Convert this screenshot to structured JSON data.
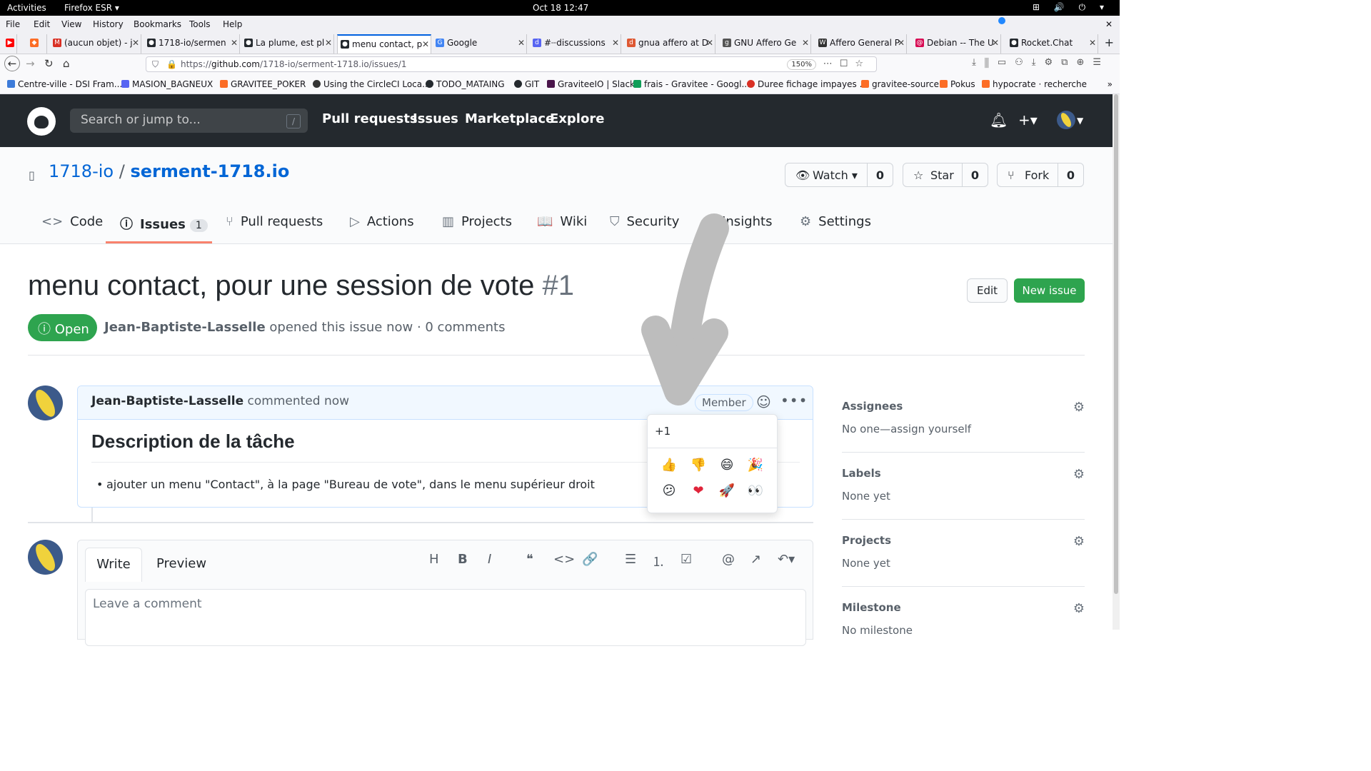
{
  "os": {
    "activities": "Activities",
    "app": "Firefox ESR ▾",
    "clock": "Oct 18  12:47",
    "tray": "⊞ 🔊 ⏻ ▾"
  },
  "menu": [
    "File",
    "Edit",
    "View",
    "History",
    "Bookmarks",
    "Tools",
    "Help"
  ],
  "tabs": [
    {
      "label": "(aucun objet) - j",
      "color": "#d93025",
      "glyph": "M"
    },
    {
      "label": "1718-io/sermen",
      "color": "#24292e",
      "glyph": "●"
    },
    {
      "label": "La plume, est pl",
      "color": "#24292e",
      "glyph": "●"
    },
    {
      "label": "menu contact, p",
      "color": "#24292e",
      "glyph": "●"
    },
    {
      "label": "Google",
      "color": "#4285f4",
      "glyph": "G"
    },
    {
      "label": "#┈discussions",
      "color": "#5865f2",
      "glyph": "d"
    },
    {
      "label": "gnua affero at D",
      "color": "#de5833",
      "glyph": "d"
    },
    {
      "label": "GNU Affero Ge",
      "color": "#555555",
      "glyph": "g"
    },
    {
      "label": "Affero General P",
      "color": "#333333",
      "glyph": "W"
    },
    {
      "label": "Debian -- The U",
      "color": "#d70a53",
      "glyph": "@"
    },
    {
      "label": "Rocket.Chat",
      "color": "#24292e",
      "glyph": "●"
    }
  ],
  "url": {
    "prefix": "https://",
    "host": "github.com",
    "path": "/1718-io/serment-1718.io/issues/1",
    "zoom": "150%"
  },
  "bookmarks": [
    {
      "label": "Centre-ville - DSI Fram...",
      "color": "#3d7bd9"
    },
    {
      "label": "MASION_BAGNEUX",
      "color": "#5865f2"
    },
    {
      "label": "GRAVITEE_POKER",
      "color": "#fc6d26"
    },
    {
      "label": "Using the CircleCI Loca...",
      "color": "#343434"
    },
    {
      "label": "TODO_MATAING",
      "color": "#24292e"
    },
    {
      "label": "GIT",
      "color": "#24292e"
    },
    {
      "label": "GraviteeIO | Slack",
      "color": "#4a154b"
    },
    {
      "label": "frais - Gravitee - Googl...",
      "color": "#0f9d58"
    },
    {
      "label": "Duree fichage impayes ...",
      "color": "#d93025"
    },
    {
      "label": "gravitee-source",
      "color": "#fc6d26"
    },
    {
      "label": "Pokus",
      "color": "#fc6d26"
    },
    {
      "label": "hypocrate · recherche",
      "color": "#fc6d26"
    }
  ],
  "github": {
    "search_placeholder": "Search or jump to...",
    "slash": "/",
    "nav": [
      "Pull requests",
      "Issues",
      "Marketplace",
      "Explore"
    ]
  },
  "repo": {
    "owner": "1718-io",
    "sep": "/",
    "name": "serment-1718.io",
    "watch": {
      "label": "Watch ▾",
      "count": "0"
    },
    "star": {
      "label": "Star",
      "count": "0"
    },
    "fork": {
      "label": "Fork",
      "count": "0"
    },
    "tabs": [
      {
        "label": "Code",
        "icon": "<>"
      },
      {
        "label": "Issues",
        "icon": "ⓘ",
        "count": "1"
      },
      {
        "label": "Pull requests",
        "icon": "⑂"
      },
      {
        "label": "Actions",
        "icon": "▷"
      },
      {
        "label": "Projects",
        "icon": "▥"
      },
      {
        "label": "Wiki",
        "icon": "📖"
      },
      {
        "label": "Security",
        "icon": "⛉"
      },
      {
        "label": "Insights",
        "icon": "∿"
      },
      {
        "label": "Settings",
        "icon": "⚙"
      }
    ]
  },
  "issue": {
    "title": "menu contact, pour une session de vote",
    "number": "#1",
    "edit": "Edit",
    "new_issue": "New issue",
    "state": "Open",
    "author": "Jean-Baptiste-Lasselle",
    "meta": "opened this issue now · 0 comments"
  },
  "comment": {
    "author": "Jean-Baptiste-Lasselle",
    "time": "commented now",
    "badge": "Member",
    "heading": "Description de la tâche",
    "bullet": "ajouter un menu \"Contact\", à la page \"Bureau de vote\", dans le menu supérieur droit"
  },
  "reactions": {
    "label": "+1",
    "emojis": [
      "👍",
      "👎",
      "😄",
      "🎉",
      "😕",
      "❤",
      "🚀",
      "👀"
    ]
  },
  "composer": {
    "write": "Write",
    "preview": "Preview",
    "placeholder": "Leave a comment",
    "tools": [
      "H",
      "B",
      "I",
      "❝",
      "<>",
      "🔗",
      "☰",
      "⒈",
      "☑",
      "@",
      "↗",
      "↶▾"
    ]
  },
  "sidebar": [
    {
      "title": "Assignees",
      "value": "No one—assign yourself"
    },
    {
      "title": "Labels",
      "value": "None yet"
    },
    {
      "title": "Projects",
      "value": "None yet"
    },
    {
      "title": "Milestone",
      "value": "No milestone"
    }
  ]
}
